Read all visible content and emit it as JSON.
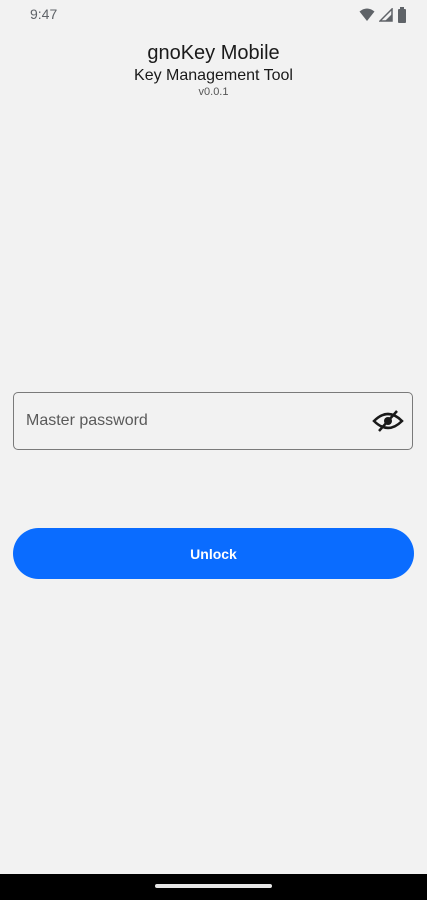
{
  "status_bar": {
    "time": "9:47",
    "icons": [
      "wifi-icon",
      "signal-icon",
      "battery-icon"
    ]
  },
  "header": {
    "title": "gnoKey Mobile",
    "subtitle": "Key Management Tool",
    "version": "v0.0.1"
  },
  "password_field": {
    "placeholder": "Master password",
    "value": "",
    "toggle_icon": "eye-off-icon"
  },
  "unlock_button": {
    "label": "Unlock"
  },
  "colors": {
    "background": "#f2f2f2",
    "primary": "#0a6cff",
    "nav_bar": "#000000"
  }
}
